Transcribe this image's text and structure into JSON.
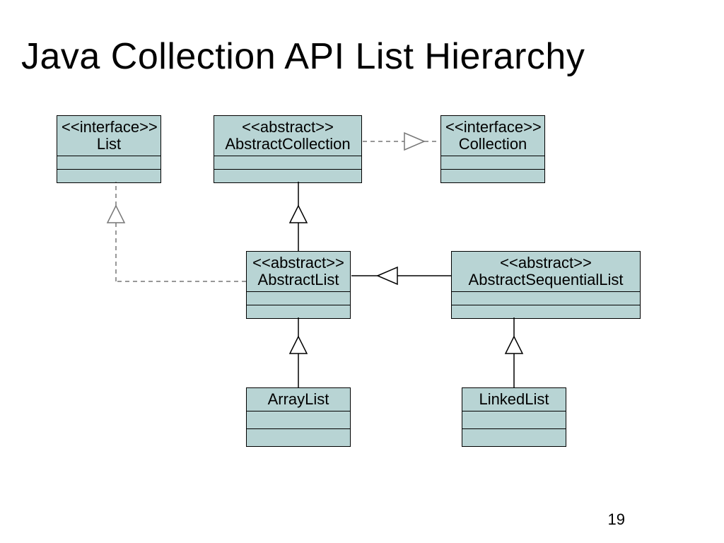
{
  "title": "Java Collection API List Hierarchy",
  "page_number": "19",
  "boxes": {
    "list": {
      "stereotype": "<<interface>>",
      "name": "List"
    },
    "abstractCollection": {
      "stereotype": "<<abstract>>",
      "name": "AbstractCollection"
    },
    "collection": {
      "stereotype": "<<interface>>",
      "name": "Collection"
    },
    "abstractList": {
      "stereotype": "<<abstract>>",
      "name": "AbstractList"
    },
    "abstractSequentialList": {
      "stereotype": "<<abstract>>",
      "name": "AbstractSequentialList"
    },
    "arrayList": {
      "name": "ArrayList"
    },
    "linkedList": {
      "name": "LinkedList"
    }
  },
  "relationships": [
    {
      "from": "ArrayList",
      "to": "AbstractList",
      "type": "extends",
      "style": "solid"
    },
    {
      "from": "LinkedList",
      "to": "AbstractSequentialList",
      "type": "extends",
      "style": "solid"
    },
    {
      "from": "AbstractSequentialList",
      "to": "AbstractList",
      "type": "extends",
      "style": "solid"
    },
    {
      "from": "AbstractList",
      "to": "AbstractCollection",
      "type": "extends",
      "style": "solid"
    },
    {
      "from": "AbstractList",
      "to": "List",
      "type": "implements",
      "style": "dashed"
    },
    {
      "from": "AbstractCollection",
      "to": "Collection",
      "type": "implements",
      "style": "dashed"
    }
  ]
}
